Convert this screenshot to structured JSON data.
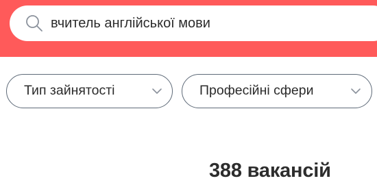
{
  "colors": {
    "header_background": "#ff5a5a",
    "search_background": "#ffffff",
    "filter_border": "#5e6a78",
    "text": "#2b2b2b",
    "chevron": "#8b929c"
  },
  "search": {
    "icon": "search-icon",
    "value": "вчитель англійської мови"
  },
  "filters": {
    "employment_type": {
      "label": "Тип зайнятості",
      "icon": "chevron-down-icon"
    },
    "professional_spheres": {
      "label": "Професійні сфери",
      "icon": "chevron-down-icon"
    }
  },
  "results": {
    "count_text": "388 вакансій"
  }
}
